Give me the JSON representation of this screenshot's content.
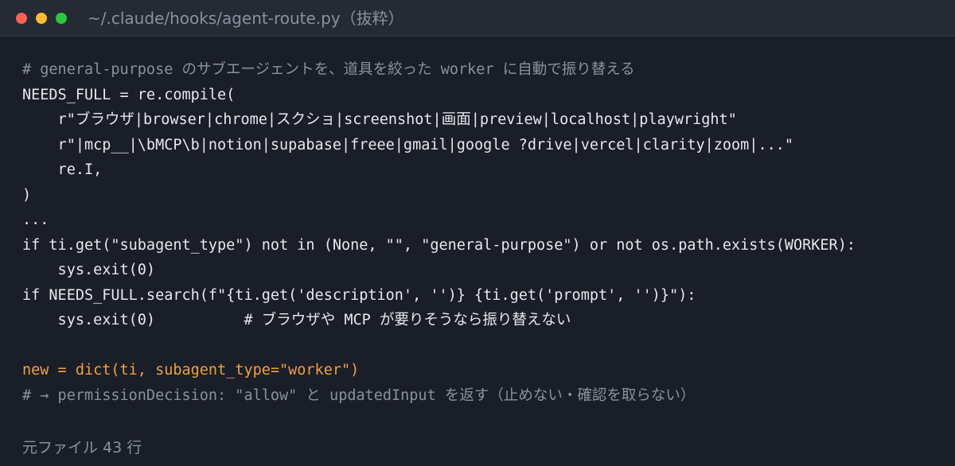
{
  "window": {
    "title": "~/.claude/hooks/agent-route.py（抜粋）",
    "traffic_lights": [
      "close",
      "minimize",
      "zoom"
    ]
  },
  "colors": {
    "background": "#1a1e28",
    "titlebar": "#252a35",
    "text": "#e6e8ec",
    "comment": "#8a919e",
    "accent": "#f0a040",
    "close": "#fe5f57",
    "minimize": "#febc2e",
    "zoom": "#28c840"
  },
  "code": {
    "lines": [
      {
        "style": "comment",
        "text": "# general-purpose のサブエージェントを、道具を絞った worker に自動で振り替える"
      },
      {
        "style": "plain",
        "text": "NEEDS_FULL = re.compile("
      },
      {
        "style": "plain",
        "text": "    r\"ブラウザ|browser|chrome|スクショ|screenshot|画面|preview|localhost|playwright\""
      },
      {
        "style": "plain",
        "text": "    r\"|mcp__|\\bMCP\\b|notion|supabase|freee|gmail|google ?drive|vercel|clarity|zoom|...\""
      },
      {
        "style": "plain",
        "text": "    re.I,"
      },
      {
        "style": "plain",
        "text": ")"
      },
      {
        "style": "plain",
        "text": "..."
      },
      {
        "style": "plain",
        "text": "if ti.get(\"subagent_type\") not in (None, \"\", \"general-purpose\") or not os.path.exists(WORKER):"
      },
      {
        "style": "plain",
        "text": "    sys.exit(0)"
      },
      {
        "style": "plain",
        "text": "if NEEDS_FULL.search(f\"{ti.get('description', '')} {ti.get('prompt', '')}\"):"
      },
      {
        "style": "plain",
        "text": "    sys.exit(0)          # ブラウザや MCP が要りそうなら振り替えない"
      },
      {
        "style": "plain",
        "text": ""
      },
      {
        "style": "accent",
        "text": "new = dict(ti, subagent_type=\"worker\")"
      },
      {
        "style": "comment",
        "text": "# → permissionDecision: \"allow\" と updatedInput を返す（止めない・確認を取らない）"
      }
    ]
  },
  "footer": {
    "line_count": "元ファイル 43 行"
  }
}
